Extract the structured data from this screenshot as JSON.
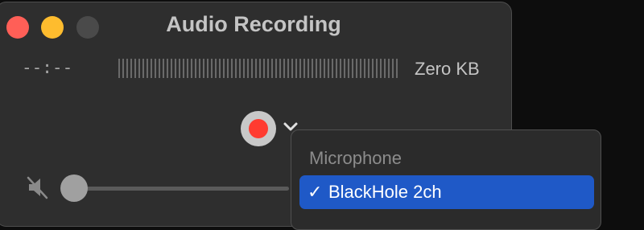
{
  "window": {
    "title": "Audio Recording",
    "elapsed_time": "--:--",
    "file_size": "Zero KB"
  },
  "menu": {
    "header": "Microphone",
    "items": [
      {
        "label": "BlackHole 2ch",
        "checked": true,
        "check_glyph": "✓"
      }
    ]
  },
  "colors": {
    "record": "#ff3b30",
    "selection": "#1f59c7",
    "close": "#ff5f57",
    "minimize": "#febc2e"
  },
  "icons": [
    "record-icon",
    "chevron-down-icon",
    "speaker-muted-icon",
    "checkmark-icon"
  ]
}
